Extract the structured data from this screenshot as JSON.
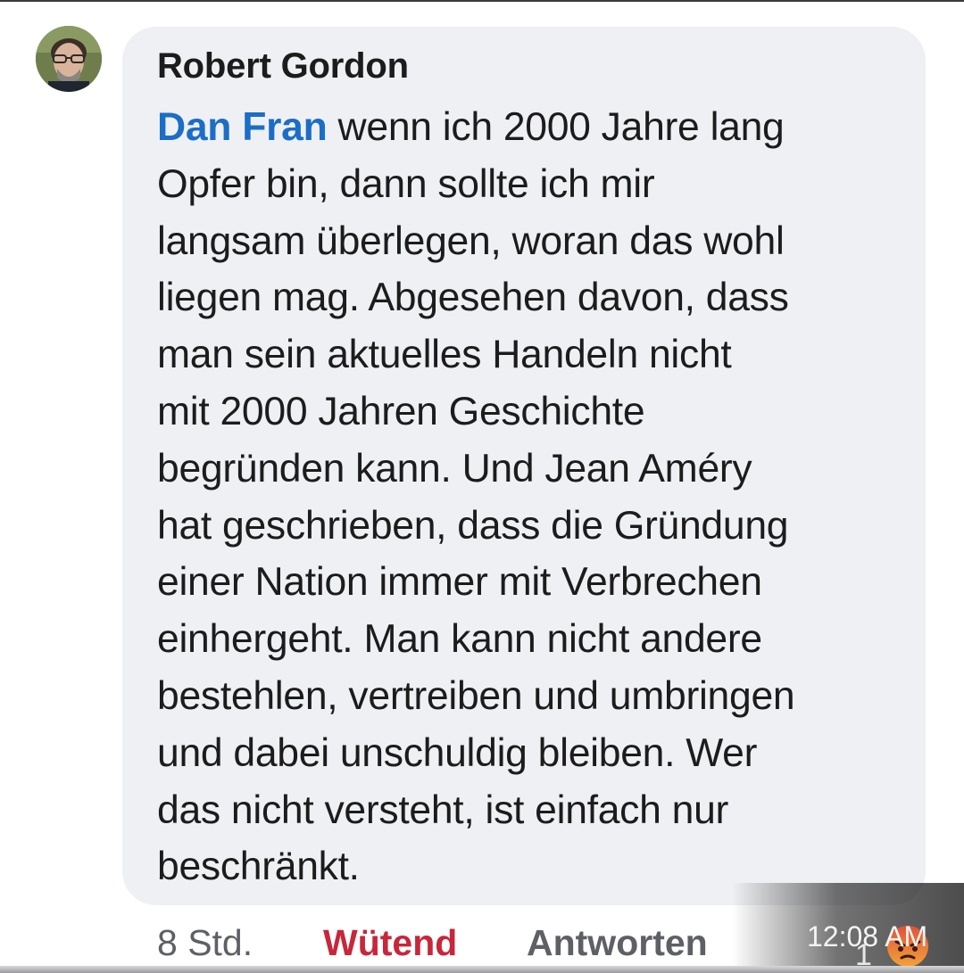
{
  "comment": {
    "author": "Robert Gordon",
    "mention": "Dan Fran",
    "lines": [
      " wenn ich 2000 Jahre lang",
      "Opfer bin, dann sollte ich mir",
      "langsam überlegen, woran das wohl",
      "liegen mag. Abgesehen davon, dass",
      "man sein aktuelles Handeln nicht",
      "mit 2000 Jahren Geschichte",
      "begründen kann. Und Jean Améry",
      "hat geschrieben, dass die Gründung",
      "einer Nation immer mit Verbrechen",
      "einhergeht. Man kann nicht andere",
      "bestehlen, vertreiben und umbringen",
      "und dabei unschuldig bleiben. Wer",
      "das nicht versteht, ist einfach nur",
      "beschränkt."
    ]
  },
  "actions": {
    "time_ago": "8 Std.",
    "reaction_label": "Wütend",
    "reply_label": "Antworten",
    "reaction_count": "1"
  },
  "status": {
    "clock": "12:08 AM"
  },
  "icons": {
    "avatar": "profile-photo",
    "reaction": "angry-face-icon"
  },
  "colors": {
    "mention": "#1b6ec6",
    "reaction_label": "#c8263a",
    "bubble": "#eff0f3"
  }
}
